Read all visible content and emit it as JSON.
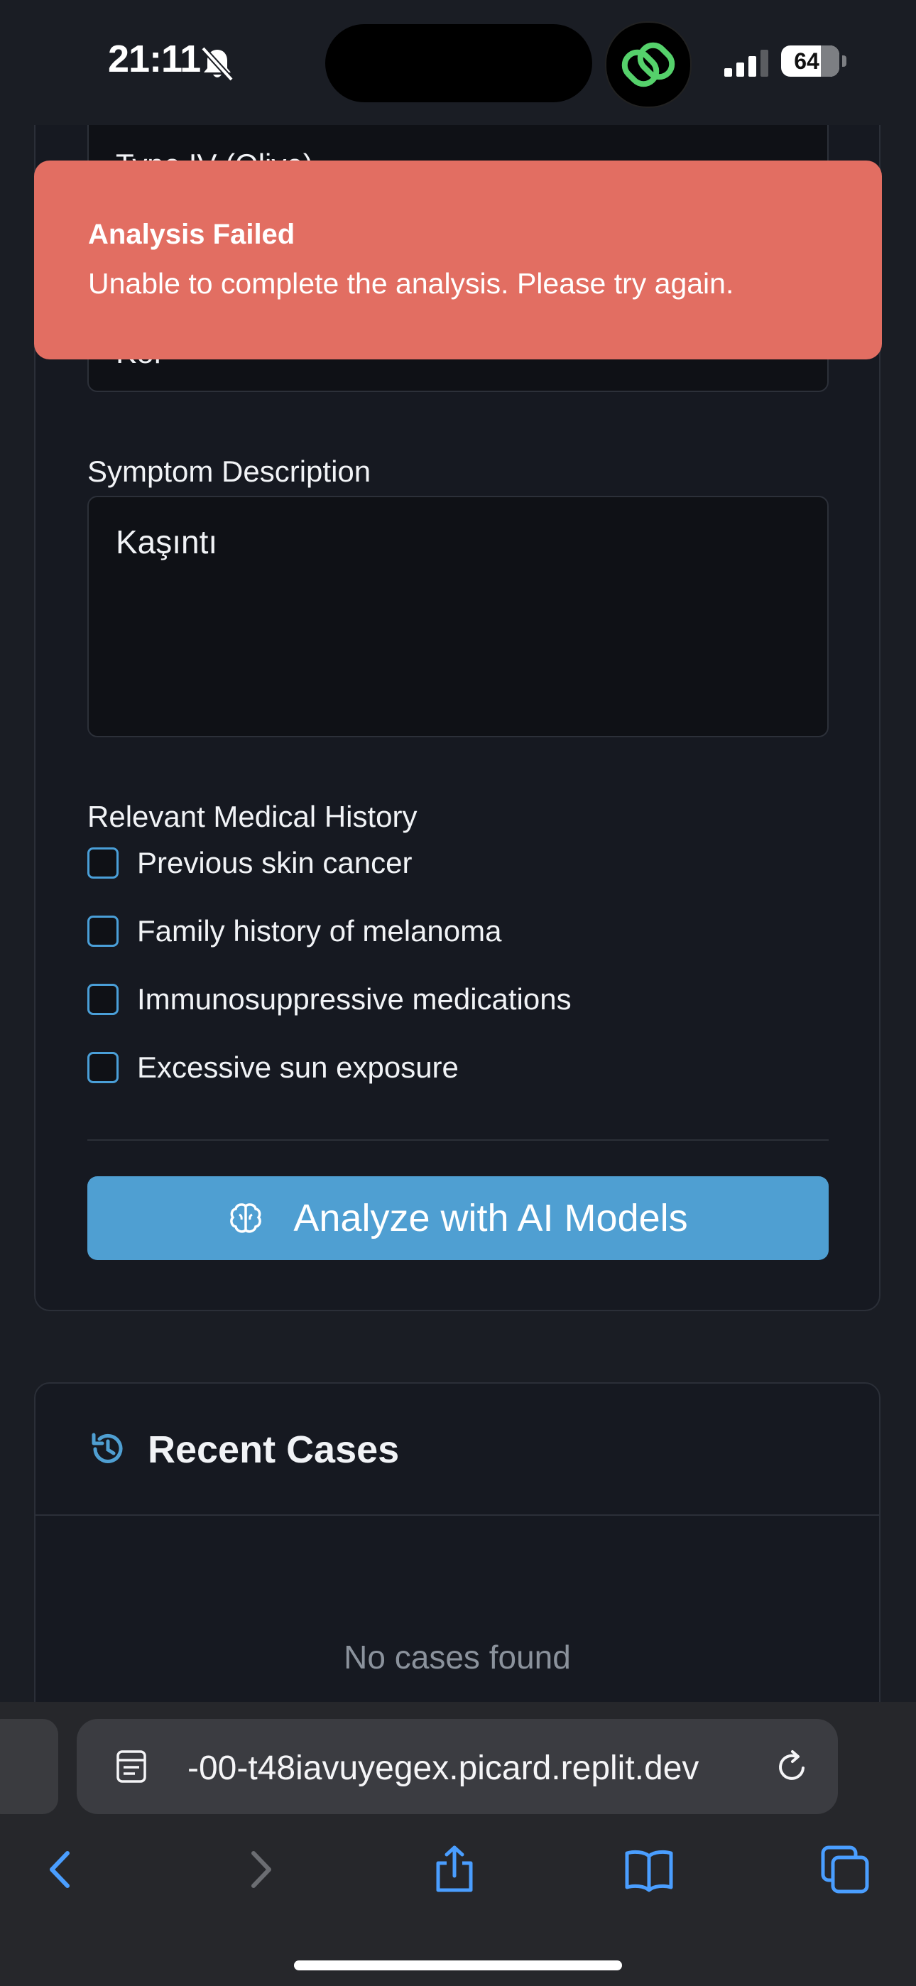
{
  "status_bar": {
    "time": "21:11",
    "battery": "64"
  },
  "form": {
    "skin_type_value": "Type IV (Olive)",
    "location_value": "Kol",
    "symptom_label": "Symptom Description",
    "symptom_value": "Kaşıntı",
    "history_label": "Relevant Medical History",
    "history_options": [
      "Previous skin cancer",
      "Family history of melanoma",
      "Immunosuppressive medications",
      "Excessive sun exposure"
    ],
    "analyze_label": "Analyze with AI Models"
  },
  "toast": {
    "title": "Analysis Failed",
    "message": "Unable to complete the analysis. Please try again."
  },
  "recent_cases": {
    "title": "Recent Cases",
    "empty_text": "No cases found"
  },
  "browser": {
    "url": "-00-t48iavuyegex.picard.replit.dev"
  },
  "colors": {
    "accent": "#4f9fd2",
    "toast": "#e26e62",
    "background": "#1a1d24"
  },
  "icons": [
    "bell-slash-icon",
    "link-app-icon",
    "signal-icon",
    "brain-icon",
    "history-icon",
    "reader-icon",
    "reload-icon",
    "back-icon",
    "forward-icon",
    "share-icon",
    "bookmarks-icon",
    "tabs-icon"
  ]
}
